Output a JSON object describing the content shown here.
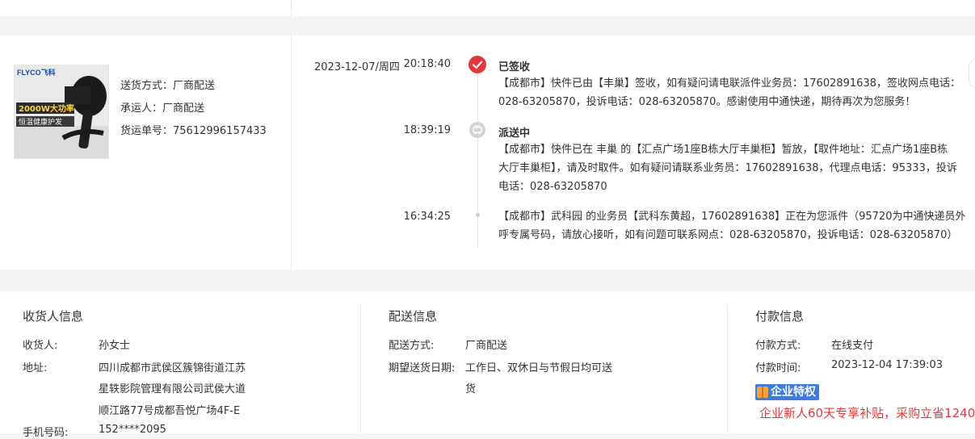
{
  "shipping": {
    "method_label": "送货方式：",
    "method_value": "厂商配送",
    "carrier_label": "承运人：",
    "carrier_value": "厂商配送",
    "waybill_label": "货运单号：",
    "waybill_value": "75612996157433"
  },
  "product_image": {
    "brand": "FLYCO飞科",
    "headline": "2000W大功率",
    "tagline": "恒温健康护发"
  },
  "timeline": {
    "date": "2023-12-07/周四",
    "events": [
      {
        "time": "20:18:40",
        "status": "已签收",
        "desc_line1": "【成都市】快件已由【丰巢】签收，如有疑问请电联派件业务员：17602891638，签收网点电话：",
        "desc_line2": "028-63205870，投诉电话：028-63205870。感谢使用中通快递，期待再次为您服务！"
      },
      {
        "time": "18:39:19",
        "status": "派送中",
        "desc_line1": "【成都市】快件已在 丰巢 的【汇点广场1座B栋大厅丰巢柜】暂放，【取件地址：汇点广场1座B栋",
        "desc_line2": "大厅丰巢柜】，请及时取件。如有疑问请联系业务员：17602891638，代理点电话：95333，投诉",
        "desc_line3": "电话：028-63205870"
      },
      {
        "time": "16:34:25",
        "desc_line1": "【成都市】武科园 的业务员【武科东黄超，17602891638】正在为您派件（95720为中通快递员外",
        "desc_line2": "呼专属号码，请放心接听，如有问题可联系网点：028-63205870，投诉电话：028-63205870）"
      }
    ]
  },
  "consignee": {
    "title": "收货人信息",
    "name_label": "收货人:",
    "name_value": "孙女士",
    "address_label": "地址:",
    "address_line1": "四川成都市武侯区簇锦街道江苏",
    "address_line2": "星轶影院管理有限公司武侯大道",
    "address_line3": "顺江路77号成都吾悦广场4F-E",
    "phone_label": "手机号码:",
    "phone_value": "152****2095"
  },
  "delivery": {
    "title": "配送信息",
    "method_label": "配送方式:",
    "method_value": "厂商配送",
    "date_label": "期望送货日期:",
    "date_line1": "工作日、双休日与节假日均可送",
    "date_line2": "货"
  },
  "payment": {
    "title": "付款信息",
    "method_label": "付款方式:",
    "method_value": "在线支付",
    "time_label": "付款时间:",
    "time_value": "2023-12-04 17:39:03",
    "badge": "企业特权",
    "promo": "企业新人60天专享补贴，采购立省1240"
  },
  "colors": {
    "accent": "#e4393c",
    "badge": "#3d7bdf"
  }
}
